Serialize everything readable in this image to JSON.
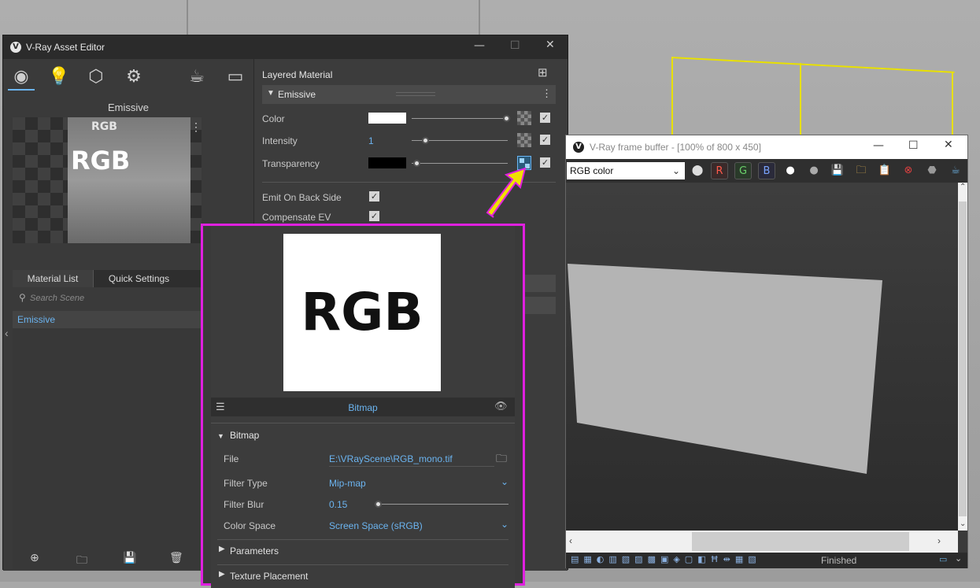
{
  "asset_editor": {
    "title": "V-Ray Asset Editor",
    "preview_label": "Emissive",
    "tabs": [
      "Material List",
      "Quick Settings"
    ],
    "search_placeholder": "Search Scene",
    "list_items": [
      "Emissive"
    ],
    "material_type": "Layered Material",
    "section": "Emissive",
    "params": {
      "color_label": "Color",
      "intensity_label": "Intensity",
      "intensity_value": "1",
      "transparency_label": "Transparency",
      "emit_back_label": "Emit On Back Side",
      "compensate_label": "Compensate EV"
    }
  },
  "bitmap_popup": {
    "preview_text": "RGB",
    "header": "Bitmap",
    "section": "Bitmap",
    "file_label": "File",
    "file_value": "E:\\VRayScene\\RGB_mono.tif",
    "filter_type_label": "Filter Type",
    "filter_type_value": "Mip-map",
    "filter_blur_label": "Filter Blur",
    "filter_blur_value": "0.15",
    "color_space_label": "Color Space",
    "color_space_value": "Screen Space (sRGB)",
    "parameters_label": "Parameters",
    "texture_placement_label": "Texture Placement"
  },
  "frame_buffer": {
    "title": "V-Ray frame buffer - [100% of 800 x 450]",
    "channel": "RGB color",
    "r_label": "R",
    "g_label": "G",
    "b_label": "B",
    "status": "Finished"
  },
  "colors": {
    "accent": "#6bb4f0",
    "highlight": "#e020e0",
    "arrow": "#f0e000"
  }
}
